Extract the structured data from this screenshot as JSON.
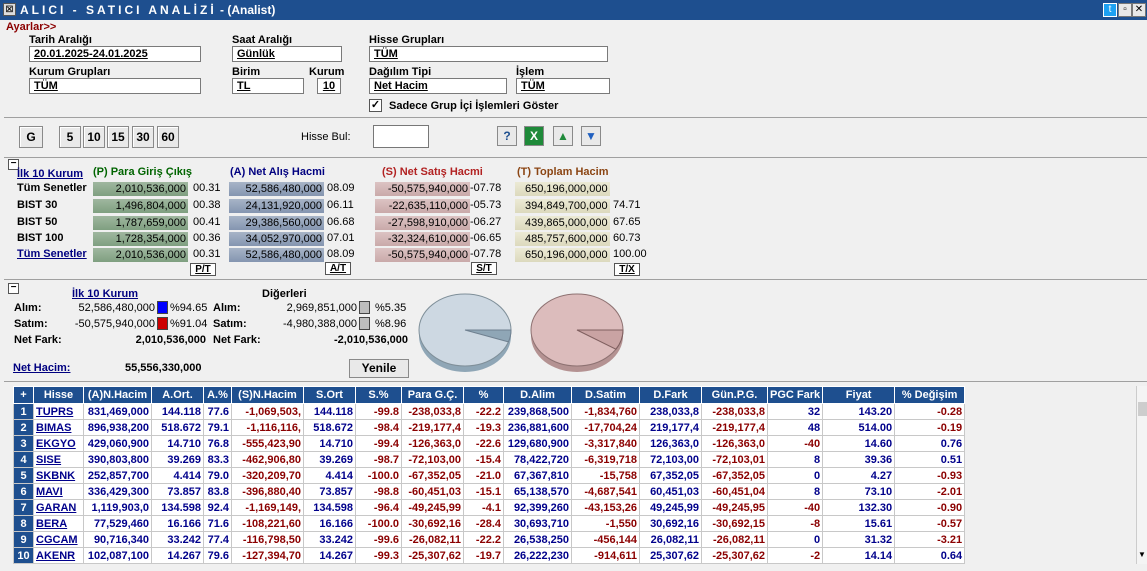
{
  "window": {
    "title_spaced": "ALICI - SATICI ANALİZİ",
    "title_suffix": " - (Analist)"
  },
  "filters": {
    "ayarlar": "Ayarlar>>",
    "tarih_label": "Tarih Aralığı",
    "tarih_value": "20.01.2025-24.01.2025",
    "saat_label": "Saat Aralığı",
    "saat_value": "Günlük",
    "hisse_grup_label": "Hisse Grupları",
    "hisse_grup_value": "TÜM",
    "kurum_grup_label": "Kurum Grupları",
    "kurum_grup_value": "TÜM",
    "birim_label": "Birim",
    "birim_value": "TL",
    "kurum_label": "Kurum",
    "kurum_value": "10",
    "dagilim_label": "Dağılım Tipi",
    "dagilim_value": "Net Hacim",
    "islem_label": "İşlem",
    "islem_value": "TÜM",
    "checkbox_label": "Sadece Grup İçi İşlemleri Göster",
    "checkbox_mark": "✓"
  },
  "toolbar": {
    "periods": [
      "G",
      "5",
      "10",
      "15",
      "30",
      "60"
    ],
    "hisse_bul_label": "Hisse Bul:",
    "icons": [
      "?",
      "X",
      "▲",
      "▼"
    ]
  },
  "summary": {
    "minus": "−",
    "ilk10": "İlk 10 Kurum",
    "h_p": "(P) Para Giriş Çıkış",
    "h_a": "(A) Net Alış Hacmi",
    "h_s": "(S) Net Satış Hacmi",
    "h_t": "(T) Toplam Hacim",
    "rows": [
      {
        "name": "Tüm Senetler",
        "link": false,
        "p": "2,010,536,000",
        "pp": "00.31",
        "a": "52,586,480,000",
        "ap": "08.09",
        "s": "-50,575,940,000",
        "sp": "-07.78",
        "t": "650,196,000,000",
        "tp": ""
      },
      {
        "name": "BIST 30",
        "link": false,
        "p": "1,496,804,000",
        "pp": "00.38",
        "a": "24,131,920,000",
        "ap": "06.11",
        "s": "-22,635,110,000",
        "sp": "-05.73",
        "t": "394,849,700,000",
        "tp": "74.71"
      },
      {
        "name": "BIST 50",
        "link": false,
        "p": "1,787,659,000",
        "pp": "00.41",
        "a": "29,386,560,000",
        "ap": "06.68",
        "s": "-27,598,910,000",
        "sp": "-06.27",
        "t": "439,865,000,000",
        "tp": "67.65"
      },
      {
        "name": "BIST 100",
        "link": false,
        "p": "1,728,354,000",
        "pp": "00.36",
        "a": "34,052,970,000",
        "ap": "07.01",
        "s": "-32,324,610,000",
        "sp": "-06.65",
        "t": "485,757,600,000",
        "tp": "60.73"
      },
      {
        "name": "Tüm Senetler",
        "link": true,
        "p": "2,010,536,000",
        "pp": "00.31",
        "a": "52,586,480,000",
        "ap": "08.09",
        "s": "-50,575,940,000",
        "sp": "-07.78",
        "t": "650,196,000,000",
        "tp": "100.00"
      }
    ],
    "tags": [
      "P/T",
      "A/T",
      "S/T",
      "T/X"
    ]
  },
  "dist": {
    "ilk10": "İlk 10 Kurum",
    "digerleri": "Diğerleri",
    "alim_label": "Alım:",
    "satim_label": "Satım:",
    "netfark_label": "Net Fark:",
    "top_alim": "52,586,480,000",
    "top_alim_pct": "%94.65",
    "top_satim": "-50,575,940,000",
    "top_satim_pct": "%91.04",
    "top_net": "2,010,536,000",
    "oth_alim": "2,969,851,000",
    "oth_alim_pct": "%5.35",
    "oth_satim": "-4,980,388,000",
    "oth_satim_pct": "%8.96",
    "oth_net": "-2,010,536,000",
    "net_hacim_label": "Net Hacim:",
    "net_hacim_value": "55,556,330,000",
    "yenile": "Yenile",
    "pie_buy_share": 0.9465,
    "pie_sell_share": 0.9104,
    "colors": {
      "blue": "#0000ff",
      "red": "#cc0000",
      "gray": "#bdbdbd",
      "pie1": "#cdd8e2",
      "pie1s": "#8fa6b6",
      "pie2": "#dcbcbc",
      "pie2s": "#b49292"
    }
  },
  "table": {
    "headers": [
      "+",
      "Hisse",
      "(A)N.Hacim",
      "A.Ort.",
      "A.%",
      "(S)N.Hacim",
      "S.Ort",
      "S.%",
      "Para G.Ç.",
      "%",
      "D.Alim",
      "D.Satim",
      "D.Fark",
      "Gün.P.G.",
      "PGC Fark",
      "Fiyat",
      "% Değişim"
    ],
    "rows": [
      [
        "1",
        "TUPRS",
        "831,469,000",
        "144.118",
        "77.6",
        "-1,069,503,",
        "144.118",
        "-99.8",
        "-238,033,8",
        "-22.2",
        "239,868,500",
        "-1,834,760",
        "238,033,8",
        "-238,033,8",
        "32",
        "143.20",
        "-0.28"
      ],
      [
        "2",
        "BIMAS",
        "896,938,200",
        "518.672",
        "79.1",
        "-1,116,116,",
        "518.672",
        "-98.4",
        "-219,177,4",
        "-19.3",
        "236,881,600",
        "-17,704,24",
        "219,177,4",
        "-219,177,4",
        "48",
        "514.00",
        "-0.19"
      ],
      [
        "3",
        "EKGYO",
        "429,060,900",
        "14.710",
        "76.8",
        "-555,423,90",
        "14.710",
        "-99.4",
        "-126,363,0",
        "-22.6",
        "129,680,900",
        "-3,317,840",
        "126,363,0",
        "-126,363,0",
        "-40",
        "14.60",
        "0.76"
      ],
      [
        "4",
        "SISE",
        "390,803,800",
        "39.269",
        "83.3",
        "-462,906,80",
        "39.269",
        "-98.7",
        "-72,103,00",
        "-15.4",
        "78,422,720",
        "-6,319,718",
        "72,103,00",
        "-72,103,01",
        "8",
        "39.36",
        "0.51"
      ],
      [
        "5",
        "SKBNK",
        "252,857,700",
        "4.414",
        "79.0",
        "-320,209,70",
        "4.414",
        "-100.0",
        "-67,352,05",
        "-21.0",
        "67,367,810",
        "-15,758",
        "67,352,05",
        "-67,352,05",
        "0",
        "4.27",
        "-0.93"
      ],
      [
        "6",
        "MAVI",
        "336,429,300",
        "73.857",
        "83.8",
        "-396,880,40",
        "73.857",
        "-98.8",
        "-60,451,03",
        "-15.1",
        "65,138,570",
        "-4,687,541",
        "60,451,03",
        "-60,451,04",
        "8",
        "73.10",
        "-2.01"
      ],
      [
        "7",
        "GARAN",
        "1,119,903,0",
        "134.598",
        "92.4",
        "-1,169,149,",
        "134.598",
        "-96.4",
        "-49,245,99",
        "-4.1",
        "92,399,260",
        "-43,153,26",
        "49,245,99",
        "-49,245,95",
        "-40",
        "132.30",
        "-0.90"
      ],
      [
        "8",
        "BERA",
        "77,529,460",
        "16.166",
        "71.6",
        "-108,221,60",
        "16.166",
        "-100.0",
        "-30,692,16",
        "-28.4",
        "30,693,710",
        "-1,550",
        "30,692,16",
        "-30,692,15",
        "-8",
        "15.61",
        "-0.57"
      ],
      [
        "9",
        "CGCAM",
        "90,716,340",
        "33.242",
        "77.4",
        "-116,798,50",
        "33.242",
        "-99.6",
        "-26,082,11",
        "-22.2",
        "26,538,250",
        "-456,144",
        "26,082,11",
        "-26,082,11",
        "0",
        "31.32",
        "-3.21"
      ],
      [
        "10",
        "AKENR",
        "102,087,100",
        "14.267",
        "79.6",
        "-127,394,70",
        "14.267",
        "-99.3",
        "-25,307,62",
        "-19.7",
        "26,222,230",
        "-914,611",
        "25,307,62",
        "-25,307,62",
        "-2",
        "14.14",
        "0.64"
      ]
    ]
  }
}
